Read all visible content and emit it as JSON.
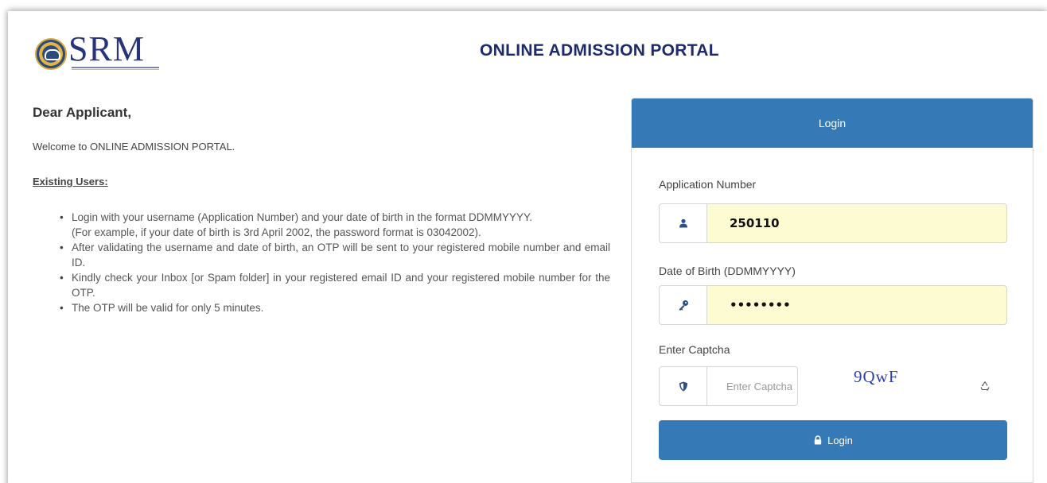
{
  "header": {
    "logo_text": "SRM",
    "title": "ONLINE ADMISSION PORTAL"
  },
  "intro": {
    "greeting": "Dear Applicant,",
    "welcome": "Welcome to ONLINE ADMISSION PORTAL.",
    "existing_heading": "Existing Users:",
    "instructions": [
      "Login with your username (Application Number) and your date of birth in the format DDMMYYYY.",
      "(For example, if your date of birth is 3rd April 2002, the password format is 03042002).",
      "After validating the username and date of birth, an OTP will be sent to your registered mobile number and email ID.",
      "Kindly check your Inbox [or Spam folder] in your registered email ID and your registered mobile number for the OTP.",
      "The OTP will be valid for only 5 minutes."
    ]
  },
  "login": {
    "header": "Login",
    "application_number": {
      "label": "Application Number",
      "value": "250110",
      "icon": "user-icon"
    },
    "dob": {
      "label": "Date of Birth (DDMMYYYY)",
      "value": "••••••••",
      "icon": "key-icon"
    },
    "captcha": {
      "label": "Enter Captcha",
      "placeholder": "Enter Captcha",
      "image_text": "9QwF",
      "icon": "shield-icon",
      "refresh_icon": "refresh-icon"
    },
    "button_label": "Login",
    "button_icon": "lock-icon"
  },
  "colors": {
    "primary": "#3579b7",
    "title": "#1d2a6b",
    "input_fill": "#fdfbd2",
    "captcha_text": "#2f3fa8"
  }
}
